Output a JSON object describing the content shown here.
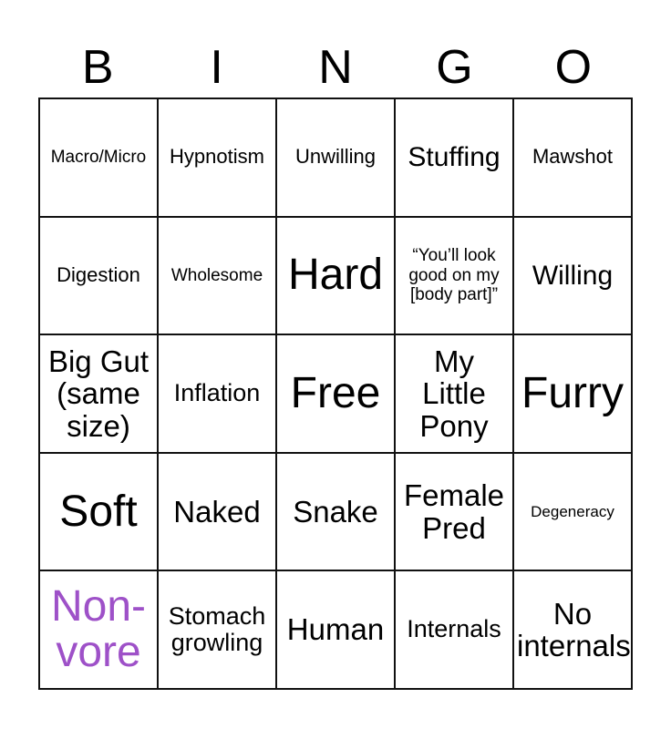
{
  "card": {
    "title": "BINGO",
    "header_letters": [
      "B",
      "I",
      "N",
      "G",
      "O"
    ],
    "columns": 5,
    "rows": 5,
    "border_color": "#111111",
    "background_color": "#ffffff",
    "default_text_color": "#000000",
    "highlight_text_color": "#9e51c8",
    "free_space": {
      "row": 3,
      "column": 3,
      "label": "Free"
    },
    "cells": [
      [
        {
          "text": "Macro/Micro",
          "size": "sm",
          "color": "#000000"
        },
        {
          "text": "Hypnotism",
          "size": "md",
          "color": "#000000"
        },
        {
          "text": "Unwilling",
          "size": "md",
          "color": "#000000"
        },
        {
          "text": "Stuffing",
          "size": "xl",
          "color": "#000000"
        },
        {
          "text": "Mawshot",
          "size": "md",
          "color": "#000000"
        }
      ],
      [
        {
          "text": "Digestion",
          "size": "md",
          "color": "#000000"
        },
        {
          "text": "Wholesome",
          "size": "sm",
          "color": "#000000"
        },
        {
          "text": "Hard",
          "size": "huge",
          "color": "#000000"
        },
        {
          "text": "“You’ll look good on my [body part]”",
          "size": "sm",
          "color": "#000000"
        },
        {
          "text": "Willing",
          "size": "xl",
          "color": "#000000"
        }
      ],
      [
        {
          "text": "Big Gut (same size)",
          "size": "xxl",
          "color": "#000000"
        },
        {
          "text": "Inflation",
          "size": "lg",
          "color": "#000000"
        },
        {
          "text": "Free",
          "size": "huge",
          "color": "#000000"
        },
        {
          "text": "My Little Pony",
          "size": "xxl",
          "color": "#000000"
        },
        {
          "text": "Furry",
          "size": "huge",
          "color": "#000000"
        }
      ],
      [
        {
          "text": "Soft",
          "size": "huge",
          "color": "#000000"
        },
        {
          "text": "Naked",
          "size": "xxl",
          "color": "#000000"
        },
        {
          "text": "Snake",
          "size": "xxl",
          "color": "#000000"
        },
        {
          "text": "Female Pred",
          "size": "xxl",
          "color": "#000000"
        },
        {
          "text": "Degeneracy",
          "size": "xs",
          "color": "#000000"
        }
      ],
      [
        {
          "text": "Non-vore",
          "size": "huge",
          "color": "#9e51c8"
        },
        {
          "text": "Stomach growling",
          "size": "lg",
          "color": "#000000"
        },
        {
          "text": "Human",
          "size": "xxl",
          "color": "#000000"
        },
        {
          "text": "Internals",
          "size": "lg",
          "color": "#000000"
        },
        {
          "text": "No internals",
          "size": "xxl",
          "color": "#000000"
        }
      ]
    ]
  }
}
